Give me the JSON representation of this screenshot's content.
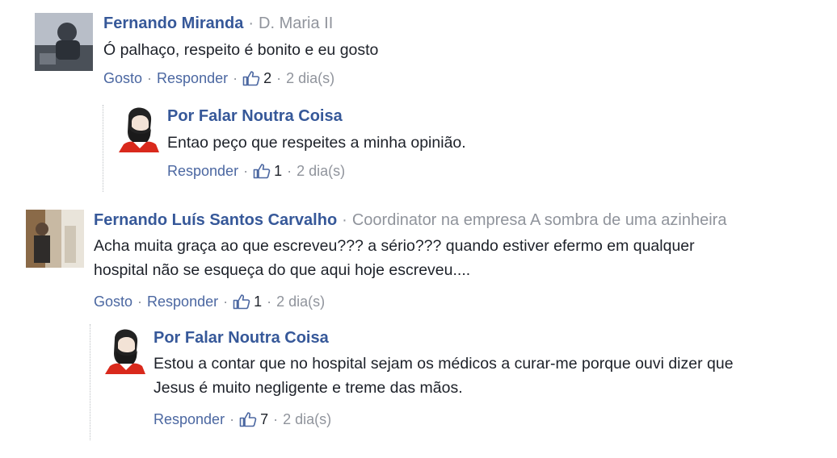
{
  "comments": [
    {
      "author": "Fernando Miranda",
      "subtitle": "D. Maria II",
      "text": "Ó palhaço, respeito é bonito e eu gosto",
      "actions": {
        "like": "Gosto",
        "reply": "Responder",
        "likes": "2",
        "time": "2 dia(s)"
      }
    },
    {
      "author": "Por Falar Noutra Coisa",
      "text": "Entao peço que respeites a minha opinião.",
      "actions": {
        "reply": "Responder",
        "likes": "1",
        "time": "2 dia(s)"
      }
    },
    {
      "author": "Fernando Luís Santos Carvalho",
      "subtitle": "Coordinator na empresa A sombra de uma azinheira",
      "text_lines": [
        "Acha muita graça ao que escreveu??? a sério??? quando estiver efermo em qualquer",
        "hospital não se esqueça do que aqui hoje escreveu...."
      ],
      "actions": {
        "like": "Gosto",
        "reply": "Responder",
        "likes": "1",
        "time": "2 dia(s)"
      }
    },
    {
      "author": "Por Falar Noutra Coisa",
      "text_lines": [
        "Estou a contar que no hospital sejam os médicos a curar-me porque ouvi dizer que",
        "Jesus é muito negligente e treme das mãos."
      ],
      "actions": {
        "reply": "Responder",
        "likes": "7",
        "time": "2 dia(s)"
      }
    }
  ],
  "icons": {
    "like": "thumbs-up-icon"
  },
  "colors": {
    "author": "#365899",
    "link": "#4b67a1",
    "muted": "#90949c",
    "text": "#1d2129"
  }
}
